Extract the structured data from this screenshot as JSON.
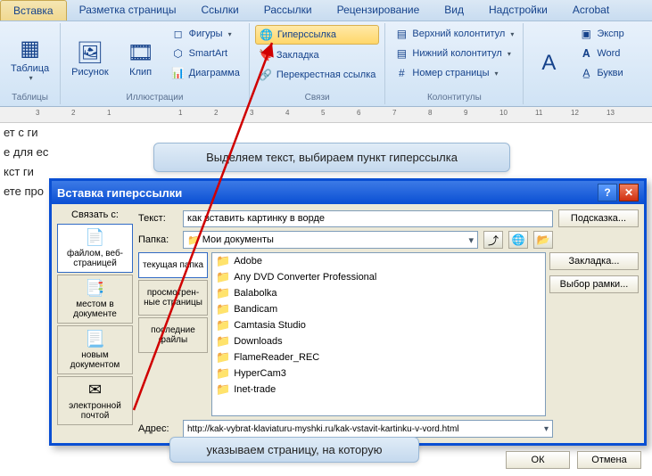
{
  "tabs": [
    "Вставка",
    "Разметка страницы",
    "Ссылки",
    "Рассылки",
    "Рецензирование",
    "Вид",
    "Надстройки",
    "Acrobat"
  ],
  "ribbon": {
    "g1": {
      "label": "Таблицы",
      "table": "Таблица"
    },
    "g2": {
      "label": "Иллюстрации",
      "pic": "Рисунок",
      "clip": "Клип",
      "shapes": "Фигуры",
      "smartart": "SmartArt",
      "chart": "Диаграмма"
    },
    "g3": {
      "label": "Связи",
      "hyperlink": "Гиперссылка",
      "bookmark": "Закладка",
      "crossref": "Перекрестная ссылка"
    },
    "g4": {
      "label": "Колонтитулы",
      "header": "Верхний колонтитул",
      "footer": "Нижний колонтитул",
      "pagenum": "Номер страницы"
    },
    "g5": {
      "express": "Экспр",
      "wordart": "Word",
      "dropcap": "Букви"
    }
  },
  "doc_lines": [
    "ет с ги",
    "е для ес",
    "кст ги",
    "ете про"
  ],
  "callout1": "Выделяем текст, выбираем пункт гиперссылка",
  "callout2": "указываем страницу, на которую",
  "dialog": {
    "title": "Вставка гиперссылки",
    "link_with": "Связать с:",
    "linkbtns": [
      {
        "icon": "📄",
        "label": "файлом, веб-страницей"
      },
      {
        "icon": "📑",
        "label": "местом в документе"
      },
      {
        "icon": "📃",
        "label": "новым документом"
      },
      {
        "icon": "✉",
        "label": "электронной почтой"
      }
    ],
    "text_label": "Текст:",
    "text_value": "как вставить картинку в ворде",
    "folder_label": "Папка:",
    "folder_value": "Мои документы",
    "viewbtns": [
      "текущая папка",
      "просмотрен-\nные страницы",
      "последние файлы"
    ],
    "files": [
      "Adobe",
      "Any DVD Converter Professional",
      "Balabolka",
      "Bandicam",
      "Camtasia Studio",
      "Downloads",
      "FlameReader_REC",
      "HyperCam3",
      "Inet-trade"
    ],
    "addr_label": "Адрес:",
    "addr_value": "http://kak-vybrat-klaviaturu-myshki.ru/kak-vstavit-kartinku-v-vord.html",
    "tip_btn": "Подсказка...",
    "bookmark_btn": "Закладка...",
    "frame_btn": "Выбор рамки...",
    "ok": "ОК",
    "cancel": "Отмена"
  }
}
